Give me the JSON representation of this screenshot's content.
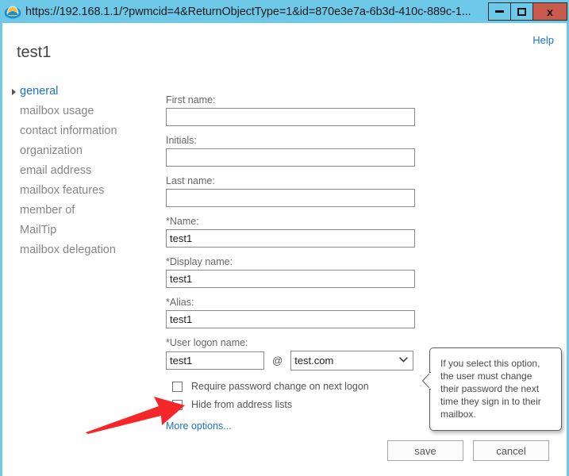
{
  "window": {
    "url": "https://192.168.1.1/?pwmcid=4&ReturnObjectType=1&id=870e3e7a-6b3d-410c-889c-1...",
    "browser_icon": "internet-explorer-icon",
    "controls": {
      "minimize": "–",
      "maximize": "□",
      "close": "x"
    },
    "chrome_color": "#6ec8e8",
    "close_button_color": "#c85a4e"
  },
  "header": {
    "help_label": "Help",
    "page_title": "test1",
    "accent_color": "#1a74c4"
  },
  "sidebar": {
    "items": [
      {
        "label": "general",
        "active": true
      },
      {
        "label": "mailbox usage",
        "active": false
      },
      {
        "label": "contact information",
        "active": false
      },
      {
        "label": "organization",
        "active": false
      },
      {
        "label": "email address",
        "active": false
      },
      {
        "label": "mailbox features",
        "active": false
      },
      {
        "label": "member of",
        "active": false
      },
      {
        "label": "MailTip",
        "active": false
      },
      {
        "label": "mailbox delegation",
        "active": false
      }
    ]
  },
  "form": {
    "fields": [
      {
        "label": "First name:",
        "value": "",
        "placeholder": ""
      },
      {
        "label": "Initials:",
        "value": "",
        "placeholder": ""
      },
      {
        "label": "Last name:",
        "value": "",
        "placeholder": ""
      },
      {
        "label": "*Name:",
        "value": "test1",
        "placeholder": ""
      },
      {
        "label": "*Display name:",
        "value": "test1",
        "placeholder": ""
      },
      {
        "label": "*Alias:",
        "value": "test1",
        "placeholder": ""
      }
    ],
    "logon": {
      "label": "*User logon name:",
      "value": "test1",
      "placeholder": "",
      "at_symbol": "@",
      "domain_selected": "test.com",
      "domain_options": [
        "test.com"
      ]
    },
    "checkboxes": [
      {
        "label": "Require password change on next logon",
        "checked": false
      },
      {
        "label": "Hide from address lists",
        "checked": false
      }
    ],
    "more_options_label": "More options..."
  },
  "tooltip": {
    "text": "If you select this option, the user must change their password the next time they sign in to their mailbox."
  },
  "footer": {
    "save_label": "save",
    "cancel_label": "cancel"
  },
  "annotation": {
    "arrow_color": "#f4262a",
    "points_at": "hide-from-address-lists-checkbox"
  }
}
